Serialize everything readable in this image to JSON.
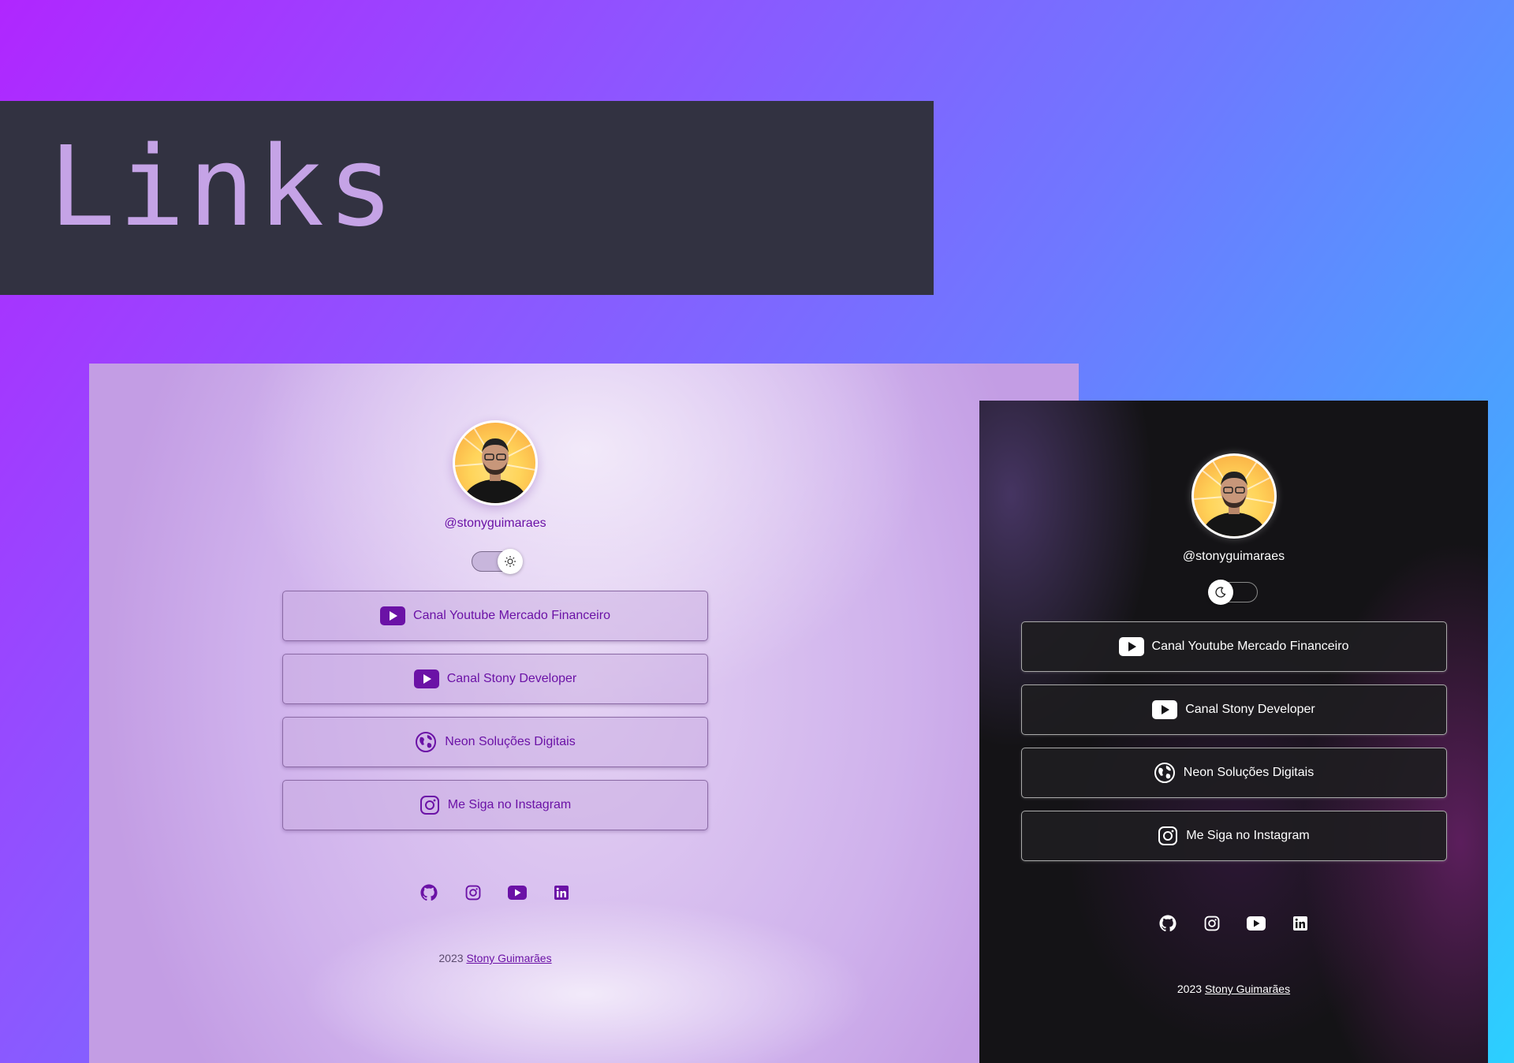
{
  "banner": {
    "title": "Links"
  },
  "light_panel": {
    "handle": "@stonyguimaraes",
    "theme_toggle": {
      "state": "light",
      "icon": "sun-icon"
    },
    "links": [
      {
        "label": "Canal Youtube Mercado Financeiro",
        "icon": "youtube-icon"
      },
      {
        "label": "Canal Stony Developer",
        "icon": "youtube-icon"
      },
      {
        "label": "Neon Soluções Digitais",
        "icon": "globe-icon"
      },
      {
        "label": "Me Siga no Instagram",
        "icon": "instagram-icon"
      }
    ],
    "socials": [
      "github-icon",
      "instagram-icon",
      "youtube-icon",
      "linkedin-icon"
    ],
    "footer": {
      "year": "2023",
      "author": "Stony Guimarães"
    },
    "accent_color": "#6b12a6"
  },
  "dark_panel": {
    "handle": "@stonyguimaraes",
    "theme_toggle": {
      "state": "dark",
      "icon": "moon-icon"
    },
    "links": [
      {
        "label": "Canal Youtube Mercado Financeiro",
        "icon": "youtube-icon"
      },
      {
        "label": "Canal Stony Developer",
        "icon": "youtube-icon"
      },
      {
        "label": "Neon Soluções Digitais",
        "icon": "globe-icon"
      },
      {
        "label": "Me Siga no Instagram",
        "icon": "instagram-icon"
      }
    ],
    "socials": [
      "github-icon",
      "instagram-icon",
      "youtube-icon",
      "linkedin-icon"
    ],
    "footer": {
      "year": "2023",
      "author": "Stony Guimarães"
    },
    "accent_color": "#ffffff"
  }
}
